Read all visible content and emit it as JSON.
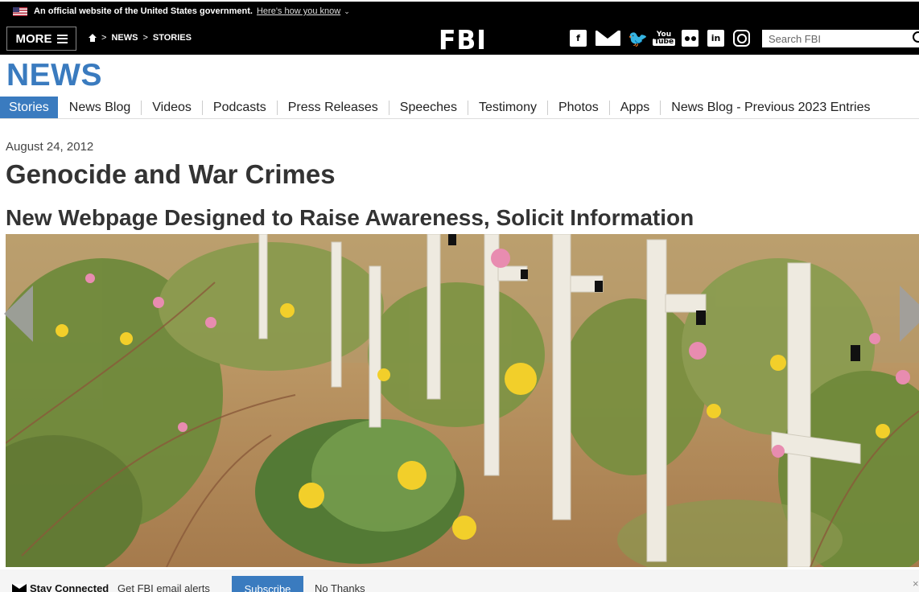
{
  "gov_banner": {
    "official_text": "An official website of the United States government.",
    "how_link": "Here's how you know",
    "chevron_glyph": "⌄"
  },
  "header": {
    "more_label": "MORE",
    "breadcrumb": {
      "sep1": ">",
      "news": "NEWS",
      "sep2": ">",
      "stories": "STORIES"
    },
    "logo": "FBI",
    "social_icons": [
      "facebook-icon",
      "email-icon",
      "twitter-icon",
      "youtube-icon",
      "flickr-icon",
      "linkedin-icon",
      "instagram-icon"
    ],
    "social_glyphs": {
      "facebook": "f",
      "twitter": "🐦",
      "youtube_top": "You",
      "youtube_bottom": "Tube",
      "linkedin": "in"
    },
    "search_placeholder": "Search FBI"
  },
  "section_title": "NEWS",
  "subnav": [
    {
      "label": "Stories",
      "active": true
    },
    {
      "label": "News Blog",
      "active": false
    },
    {
      "label": "Videos",
      "active": false
    },
    {
      "label": "Podcasts",
      "active": false
    },
    {
      "label": "Press Releases",
      "active": false
    },
    {
      "label": "Speeches",
      "active": false
    },
    {
      "label": "Testimony",
      "active": false
    },
    {
      "label": "Photos",
      "active": false
    },
    {
      "label": "Apps",
      "active": false
    },
    {
      "label": "News Blog - Previous 2023 Entries",
      "active": false
    }
  ],
  "article": {
    "date": "August 24, 2012",
    "title": "Genocide and War Crimes",
    "subtitle": "New Webpage Designed to Raise Awareness, Solicit Information"
  },
  "stay_connected": {
    "label": "Stay Connected",
    "description": "Get FBI email alerts",
    "subscribe": "Subscribe",
    "no_thanks": "No Thanks",
    "close": "×"
  },
  "colors": {
    "accent": "#3a7bbf",
    "header_bg": "#000000"
  }
}
